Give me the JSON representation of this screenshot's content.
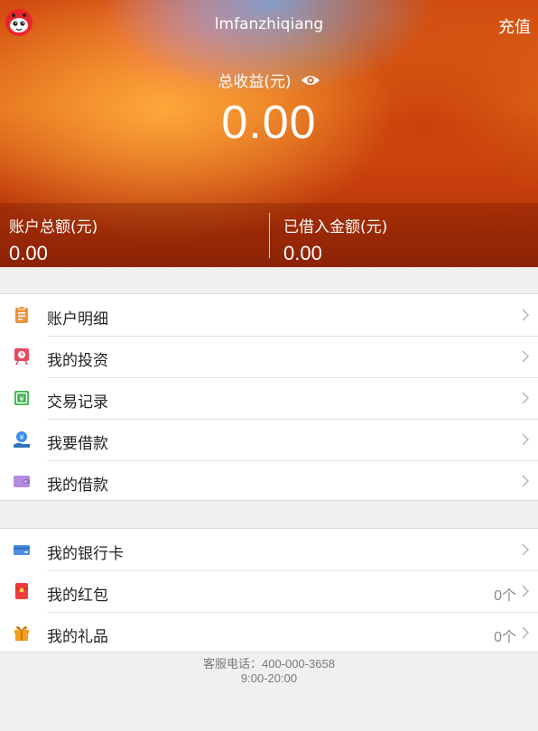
{
  "header": {
    "username": "lmfanzhiqiang",
    "recharge_label": "充值",
    "avatar_icon": "ladybug-avatar-icon"
  },
  "summary": {
    "total_income_label": "总收益(元)",
    "total_income_value": "0.00",
    "visibility_icon": "eye-icon",
    "account_total_label": "账户总额(元)",
    "account_total_value": "0.00",
    "borrowed_label": "已借入金额(元)",
    "borrowed_value": "0.00"
  },
  "menu_group_1": [
    {
      "label": "账户明细",
      "icon": "clipboard-icon",
      "color": "#f0923a"
    },
    {
      "label": "我的投资",
      "icon": "investment-alarm-icon",
      "color": "#e84a5f"
    },
    {
      "label": "交易记录",
      "icon": "transaction-record-icon",
      "color": "#3cb44b"
    },
    {
      "label": "我要借款",
      "icon": "money-hand-icon",
      "color": "#3a8ee6"
    },
    {
      "label": "我的借款",
      "icon": "wallet-icon",
      "color": "#b48be0"
    }
  ],
  "menu_group_2": [
    {
      "label": "我的银行卡",
      "icon": "bank-card-icon",
      "color": "#4a8fe0",
      "count": ""
    },
    {
      "label": "我的红包",
      "icon": "red-envelope-icon",
      "color": "#f03c3c",
      "count": "0个"
    },
    {
      "label": "我的礼品",
      "icon": "gift-icon",
      "color": "#f0a020",
      "count": "0个"
    }
  ],
  "footer": {
    "hotline": "客服电话：400-000-3658",
    "hours": "9:00-20:00"
  }
}
